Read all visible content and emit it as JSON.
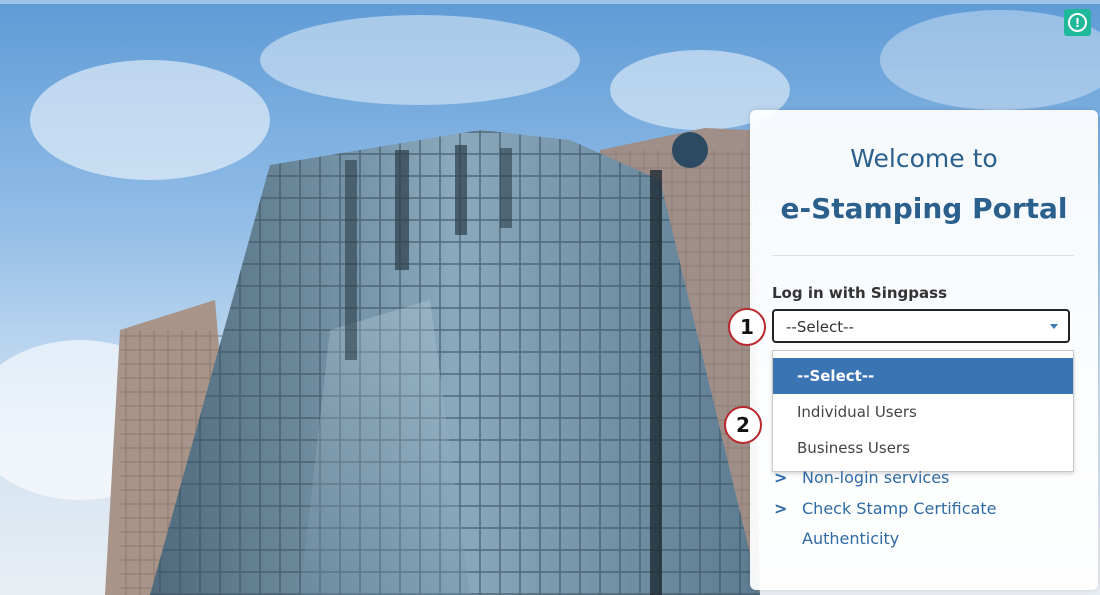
{
  "alert": {
    "icon": "exclamation-circle-icon",
    "glyph": "!",
    "color": "#1fb89a"
  },
  "panel": {
    "welcome_line1": "Welcome to",
    "welcome_line2": "e-Stamping Portal",
    "login_label": "Log in with Singpass",
    "select": {
      "value": "--Select--"
    },
    "dropdown": {
      "options": [
        "--Select--",
        "Individual Users",
        "Business Users"
      ],
      "selected_index": 0
    },
    "links": [
      {
        "chevron": ">",
        "label": "Non-login services"
      },
      {
        "chevron": ">",
        "label": "Check Stamp Certificate",
        "label_line2": "Authenticity"
      }
    ]
  },
  "annotations": [
    "1",
    "2"
  ],
  "colors": {
    "accent": "#2b5f8c",
    "link": "#2f6aa6",
    "selected_option": "#3a74b3",
    "marker_border": "#b8282e"
  }
}
